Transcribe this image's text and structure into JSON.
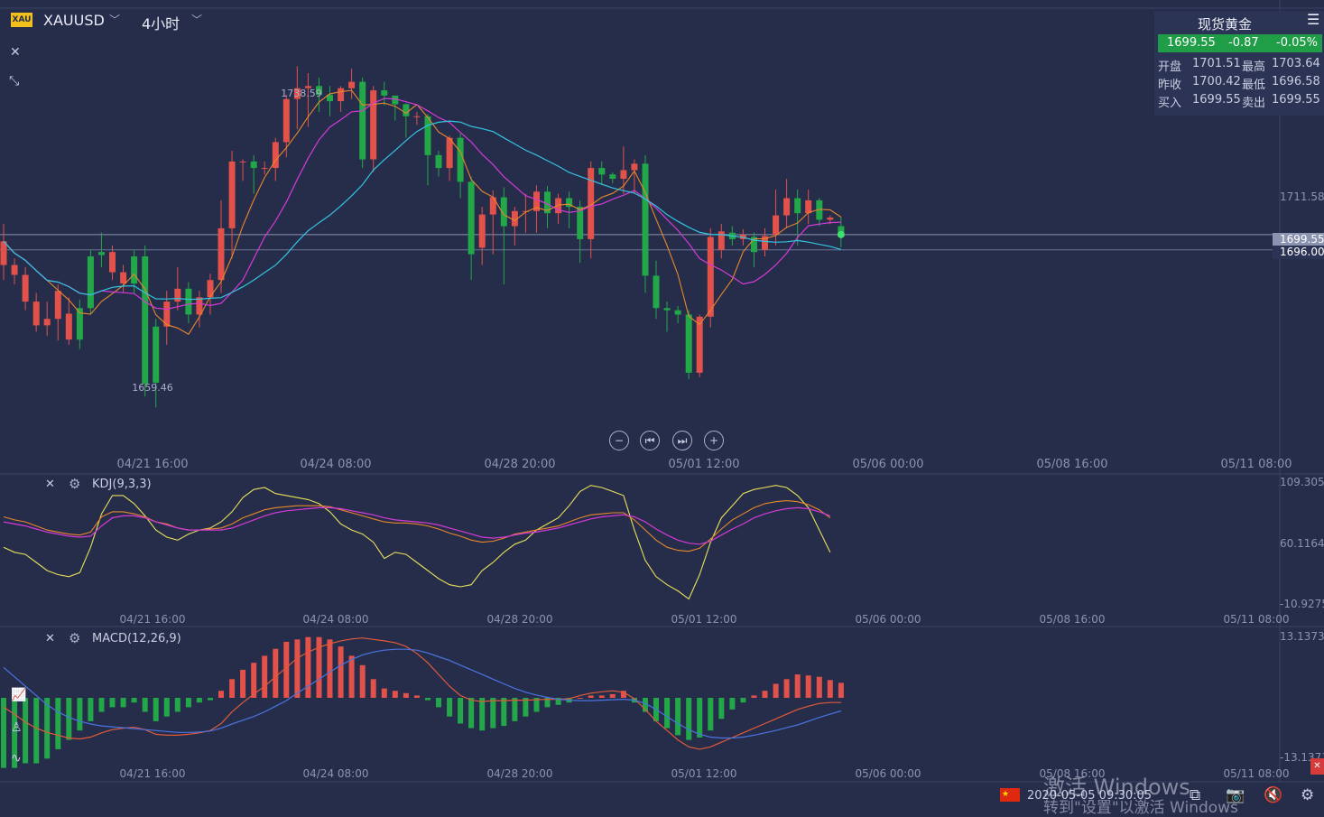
{
  "toolbar": {
    "symbol_icon": "XAU",
    "symbol": "XAUUSD",
    "period": "4小时",
    "close_icon": "✕",
    "collapse_icon": "⤡"
  },
  "quote": {
    "title": "现货黄金",
    "price": "1699.55",
    "change": "-0.87",
    "change_pct": "-0.05%",
    "open_label": "开盘",
    "open": "1701.51",
    "high_label": "最高",
    "high": "1703.64",
    "prev_label": "昨收",
    "prev": "1700.42",
    "low_label": "最低",
    "low": "1696.58",
    "buy_label": "买入",
    "buy": "1699.55",
    "sell_label": "卖出",
    "sell": "1699.55"
  },
  "controls": {
    "zoom_out": "−",
    "prev": "⏮",
    "next": "⏭",
    "zoom_in": "+"
  },
  "colors": {
    "up": "#e2514a",
    "down": "#22a848",
    "bg": "#262d4b",
    "ma_short": "#e8872c",
    "ma_mid": "#d43ad6",
    "ma_long": "#33c4e0",
    "k": "#e8e05a",
    "d": "#e8872c",
    "j": "#d43ad6",
    "macd_dif": "#e05a3a",
    "macd_dea": "#4a74e0"
  },
  "x_labels": [
    "04/21 16:00",
    "04/24 08:00",
    "04/28 20:00",
    "05/01 12:00",
    "05/06 00:00",
    "05/08 16:00",
    "05/11 08:00"
  ],
  "kdj": {
    "label": "KDJ(9,3,3)",
    "top": "109.305",
    "mid": "60.1164",
    "bot": "-10.9275"
  },
  "macd": {
    "label": "MACD(12,26,9)",
    "top": "13.13734",
    "bot": "-13.13734"
  },
  "status": {
    "time": "2020-05-05 09:30:05",
    "watermark_line1": "激活 Windows",
    "watermark_line2": "转到\"设置\"以激活 Windows"
  },
  "chart_data": {
    "type": "candlestick",
    "title": "XAUUSD",
    "y_axis_price_labels": [
      "1711.58",
      "1699.55",
      "1696.00"
    ],
    "annotations": [
      {
        "text": "1738.59",
        "kind": "high"
      },
      {
        "text": "1659.46",
        "kind": "low"
      }
    ],
    "last_price": 1699.55,
    "horizontal_line": 1696.0,
    "candles": [
      [
        1692.5,
        1698.0,
        1689.0,
        1702.0
      ],
      [
        1690.2,
        1692.5,
        1688.0,
        1694.0
      ],
      [
        1684.0,
        1690.2,
        1682.0,
        1692.0
      ],
      [
        1678.5,
        1684.0,
        1677.0,
        1686.0
      ],
      [
        1678.5,
        1680.0,
        1676.0,
        1684.0
      ],
      [
        1680.0,
        1686.5,
        1675.0,
        1688.0
      ],
      [
        1675.2,
        1681.2,
        1674.0,
        1685.0
      ],
      [
        1682.5,
        1675.2,
        1673.0,
        1684.5
      ],
      [
        1694.5,
        1682.5,
        1681.0,
        1696.0
      ],
      [
        1695.5,
        1694.8,
        1692.0,
        1700.0
      ],
      [
        1690.8,
        1695.5,
        1689.0,
        1697.0
      ],
      [
        1688.2,
        1690.8,
        1686.0,
        1692.5
      ],
      [
        1694.5,
        1688.2,
        1686.0,
        1696.0
      ],
      [
        1694.5,
        1665.0,
        1662.0,
        1697.0
      ],
      [
        1678.2,
        1665.2,
        1659.46,
        1680.0
      ],
      [
        1678.2,
        1684.0,
        1674.0,
        1686.5
      ],
      [
        1684.0,
        1687.0,
        1682.0,
        1692.0
      ],
      [
        1687.0,
        1681.0,
        1679.0,
        1688.5
      ],
      [
        1681.0,
        1685.0,
        1678.0,
        1686.5
      ],
      [
        1685.0,
        1689.0,
        1681.0,
        1690.5
      ],
      [
        1689.0,
        1701.0,
        1686.0,
        1707.5
      ],
      [
        1701.0,
        1716.5,
        1694.0,
        1719.0
      ],
      [
        1716.5,
        1716.5,
        1712.0,
        1717.0
      ],
      [
        1716.5,
        1715.0,
        1709.0,
        1718.0
      ],
      [
        1715.0,
        1715.0,
        1713.5,
        1716.5
      ],
      [
        1715.0,
        1721.0,
        1712.0,
        1722.0
      ],
      [
        1721.0,
        1731.0,
        1717.5,
        1732.0
      ],
      [
        1731.0,
        1733.5,
        1724.0,
        1738.59
      ],
      [
        1733.5,
        1734.0,
        1724.5,
        1737.0
      ],
      [
        1734.0,
        1732.0,
        1728.0,
        1736.0
      ],
      [
        1732.0,
        1730.5,
        1727.0,
        1734.0
      ],
      [
        1730.5,
        1733.5,
        1728.0,
        1734.0
      ],
      [
        1733.5,
        1735.0,
        1731.0,
        1738.0
      ],
      [
        1735.0,
        1717.0,
        1715.0,
        1736.0
      ],
      [
        1717.0,
        1733.0,
        1714.0,
        1734.0
      ],
      [
        1733.0,
        1731.8,
        1729.5,
        1735.0
      ],
      [
        1731.8,
        1729.8,
        1726.0,
        1731.0
      ],
      [
        1729.8,
        1727.0,
        1722.0,
        1730.0
      ],
      [
        1727.0,
        1727.0,
        1725.0,
        1728.0
      ],
      [
        1727.0,
        1718.0,
        1711.0,
        1727.5
      ],
      [
        1718.0,
        1715.0,
        1713.0,
        1719.0
      ],
      [
        1715.0,
        1722.0,
        1712.0,
        1722.5
      ],
      [
        1722.0,
        1711.8,
        1708.0,
        1723.0
      ],
      [
        1711.8,
        1695.0,
        1689.0,
        1713.0
      ],
      [
        1696.5,
        1704.2,
        1692.5,
        1706.0
      ],
      [
        1704.2,
        1708.2,
        1695.0,
        1709.8
      ],
      [
        1708.2,
        1701.5,
        1688.0,
        1710.5
      ],
      [
        1701.5,
        1705.0,
        1697.0,
        1706.0
      ],
      [
        1705.0,
        1705.0,
        1700.0,
        1709.0
      ],
      [
        1705.0,
        1709.5,
        1700.0,
        1711.0
      ],
      [
        1709.5,
        1704.5,
        1701.0,
        1710.8
      ],
      [
        1704.5,
        1708.0,
        1702.0,
        1709.0
      ],
      [
        1708.0,
        1706.0,
        1701.0,
        1709.5
      ],
      [
        1706.0,
        1698.5,
        1693.0,
        1707.5
      ],
      [
        1698.5,
        1715.0,
        1694.0,
        1716.5
      ],
      [
        1715.0,
        1713.5,
        1711.0,
        1716.5
      ],
      [
        1713.5,
        1712.5,
        1711.5,
        1714.0
      ],
      [
        1712.5,
        1714.5,
        1709.0,
        1720.0
      ],
      [
        1714.5,
        1716.0,
        1709.0,
        1717.0
      ],
      [
        1716.0,
        1690.0,
        1686.0,
        1718.0
      ],
      [
        1690.0,
        1682.5,
        1680.0,
        1693.5
      ],
      [
        1682.5,
        1682.0,
        1677.0,
        1684.0
      ],
      [
        1682.0,
        1681.0,
        1679.0,
        1683.0
      ],
      [
        1681.0,
        1667.5,
        1666.0,
        1682.0
      ],
      [
        1667.5,
        1680.5,
        1666.5,
        1681.0
      ],
      [
        1680.5,
        1699.0,
        1678.0,
        1701.0
      ],
      [
        1696.0,
        1700.3,
        1694.0,
        1702.0
      ],
      [
        1700.0,
        1698.5,
        1697.0,
        1701.5
      ],
      [
        1698.5,
        1699.5,
        1697.0,
        1700.8
      ],
      [
        1699.0,
        1695.5,
        1692.0,
        1700.0
      ],
      [
        1696.0,
        1699.2,
        1694.5,
        1701.0
      ],
      [
        1699.5,
        1704.0,
        1697.0,
        1710.0
      ],
      [
        1704.0,
        1708.0,
        1701.0,
        1712.5
      ],
      [
        1708.0,
        1704.5,
        1697.0,
        1710.0
      ],
      [
        1704.5,
        1707.5,
        1702.0,
        1710.0
      ],
      [
        1707.5,
        1703.0,
        1701.5,
        1708.0
      ],
      [
        1703.0,
        1703.5,
        1702.0,
        1704.0
      ],
      [
        1701.51,
        1699.55,
        1696.58,
        1703.64
      ]
    ],
    "kdj_series": {
      "K": [
        75,
        72,
        70,
        66,
        62,
        60,
        58,
        57,
        60,
        75,
        80,
        80,
        78,
        75,
        70,
        68,
        64,
        62,
        62,
        63,
        64,
        68,
        74,
        78,
        82,
        84,
        85,
        86,
        86,
        86,
        85,
        82,
        79,
        76,
        73,
        70,
        69,
        69,
        68,
        66,
        63,
        59,
        56,
        52,
        50,
        51,
        54,
        58,
        60,
        62,
        64,
        66,
        70,
        74,
        77,
        78,
        79,
        79,
        72,
        62,
        52,
        45,
        42,
        41,
        44,
        53,
        63,
        72,
        78,
        84,
        88,
        90,
        91,
        90,
        87,
        82,
        74
      ],
      "D": [
        70,
        68,
        66,
        63,
        60,
        58,
        56,
        55,
        56,
        66,
        74,
        76,
        76,
        74,
        70,
        67,
        64,
        62,
        62,
        62,
        62,
        64,
        68,
        72,
        76,
        79,
        81,
        82,
        83,
        84,
        84,
        83,
        81,
        79,
        77,
        74,
        72,
        71,
        70,
        69,
        67,
        64,
        61,
        58,
        55,
        54,
        55,
        57,
        59,
        60,
        62,
        64,
        67,
        70,
        73,
        75,
        76,
        77,
        75,
        70,
        63,
        57,
        52,
        49,
        48,
        51,
        57,
        63,
        68,
        74,
        78,
        81,
        83,
        84,
        83,
        80,
        76
      ],
      "J": [
        45,
        40,
        38,
        30,
        22,
        18,
        16,
        20,
        45,
        78,
        96,
        96,
        88,
        76,
        62,
        55,
        52,
        58,
        62,
        64,
        70,
        80,
        94,
        102,
        104,
        98,
        96,
        94,
        92,
        88,
        80,
        68,
        62,
        58,
        50,
        34,
        40,
        38,
        30,
        22,
        14,
        8,
        6,
        8,
        22,
        30,
        40,
        48,
        52,
        62,
        68,
        74,
        86,
        100,
        106,
        104,
        100,
        96,
        62,
        32,
        16,
        8,
        2,
        -6,
        18,
        50,
        74,
        86,
        98,
        102,
        104,
        106,
        104,
        96,
        84,
        62,
        40
      ]
    },
    "macd_series": {
      "DIF": [
        -2,
        -3.5,
        -5.2,
        -6.5,
        -7.4,
        -8,
        -8.6,
        -8.8,
        -8.4,
        -7.5,
        -6.8,
        -6.5,
        -6.3,
        -6.8,
        -7.8,
        -8.0,
        -8.0,
        -7.8,
        -7.5,
        -7.0,
        -5.5,
        -3.0,
        -1.0,
        0.8,
        2.5,
        4.5,
        6.5,
        8.5,
        9.8,
        10.8,
        11.6,
        12.2,
        12.6,
        12.8,
        12.5,
        12.2,
        11.8,
        11.0,
        9.5,
        7.5,
        5.0,
        2.5,
        0.5,
        -0.5,
        -0.8,
        -0.6,
        -0.6,
        -0.5,
        -0.5,
        -0.4,
        -0.3,
        -0.3,
        -0.2,
        0.5,
        1.0,
        1.3,
        1.5,
        1.2,
        -0.2,
        -2.5,
        -5.0,
        -7.0,
        -9.0,
        -10.5,
        -11.0,
        -10.5,
        -9.5,
        -8.5,
        -7.5,
        -6.5,
        -5.5,
        -4.5,
        -3.5,
        -2.5,
        -1.8,
        -1.2,
        -1.0,
        -1.0
      ],
      "DEA": [
        6.5,
        4.5,
        2.5,
        0.5,
        -1.5,
        -3.0,
        -4.2,
        -5.0,
        -5.6,
        -6.0,
        -6.2,
        -6.4,
        -6.6,
        -6.8,
        -7.0,
        -7.2,
        -7.4,
        -7.4,
        -7.3,
        -7.1,
        -6.5,
        -5.6,
        -4.8,
        -4.0,
        -3.0,
        -1.8,
        -0.6,
        1.0,
        2.5,
        4.0,
        5.5,
        7.0,
        8.2,
        9.2,
        9.8,
        10.2,
        10.4,
        10.4,
        10.2,
        9.6,
        8.8,
        8.0,
        7.0,
        6.0,
        5.0,
        4.0,
        3.0,
        2.0,
        1.2,
        0.6,
        0.1,
        -0.3,
        -0.5,
        -0.6,
        -0.6,
        -0.5,
        -0.4,
        -0.3,
        -0.5,
        -1.2,
        -2.5,
        -4.0,
        -5.5,
        -6.8,
        -7.8,
        -8.4,
        -8.6,
        -8.6,
        -8.4,
        -8.0,
        -7.5,
        -7.0,
        -6.4,
        -5.8,
        -5.0,
        -4.2,
        -3.5,
        -2.8
      ],
      "HIST": [
        -15,
        -15,
        -14,
        -14,
        -13,
        -11,
        -9,
        -7,
        -5,
        -3,
        -2,
        -2,
        -1,
        -3,
        -5,
        -4,
        -3,
        -2,
        -1,
        -0.5,
        1.5,
        4,
        6,
        7.5,
        9,
        10.5,
        12,
        12.5,
        13,
        13,
        12.5,
        11,
        9,
        7,
        4,
        2,
        1.5,
        1,
        0.5,
        -0.5,
        -2,
        -4,
        -5.5,
        -6.5,
        -7,
        -6.5,
        -6,
        -5,
        -4,
        -3,
        -2,
        -1.5,
        -1,
        0,
        0.5,
        0.5,
        0.8,
        1.5,
        -1,
        -3,
        -5,
        -6.5,
        -8,
        -9,
        -8.5,
        -7,
        -4.5,
        -2.5,
        -1,
        0.5,
        1.5,
        3,
        4,
        5,
        4.8,
        4.5,
        3.8,
        3.2
      ]
    }
  }
}
